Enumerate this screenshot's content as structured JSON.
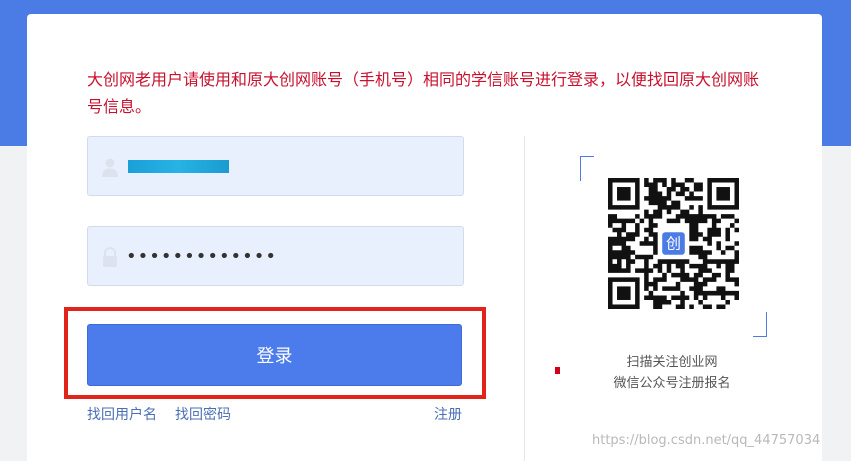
{
  "notice": {
    "text": "大创网老用户请使用和原大创网账号（手机号）相同的学信账号进行登录，以便找回原大创网账号信息。"
  },
  "form": {
    "username": {
      "value": "",
      "icon": "user-icon"
    },
    "password": {
      "value": "•••••••••••••",
      "icon": "lock-icon"
    },
    "login_label": "登录",
    "links": {
      "find_username": "找回用户名",
      "find_password": "找回密码",
      "register": "注册"
    }
  },
  "qr": {
    "caption_line1": "扫描关注创业网",
    "caption_line2": "微信公众号注册报名",
    "center_logo_text": "创"
  },
  "watermark": "https://blog.csdn.net/qq_44757034",
  "colors": {
    "brand_blue": "#4b7be5",
    "button_blue": "#4c7bec",
    "notice_red": "#c8102e",
    "highlight_red": "#e2231a",
    "link_blue": "#4a6fb5"
  }
}
